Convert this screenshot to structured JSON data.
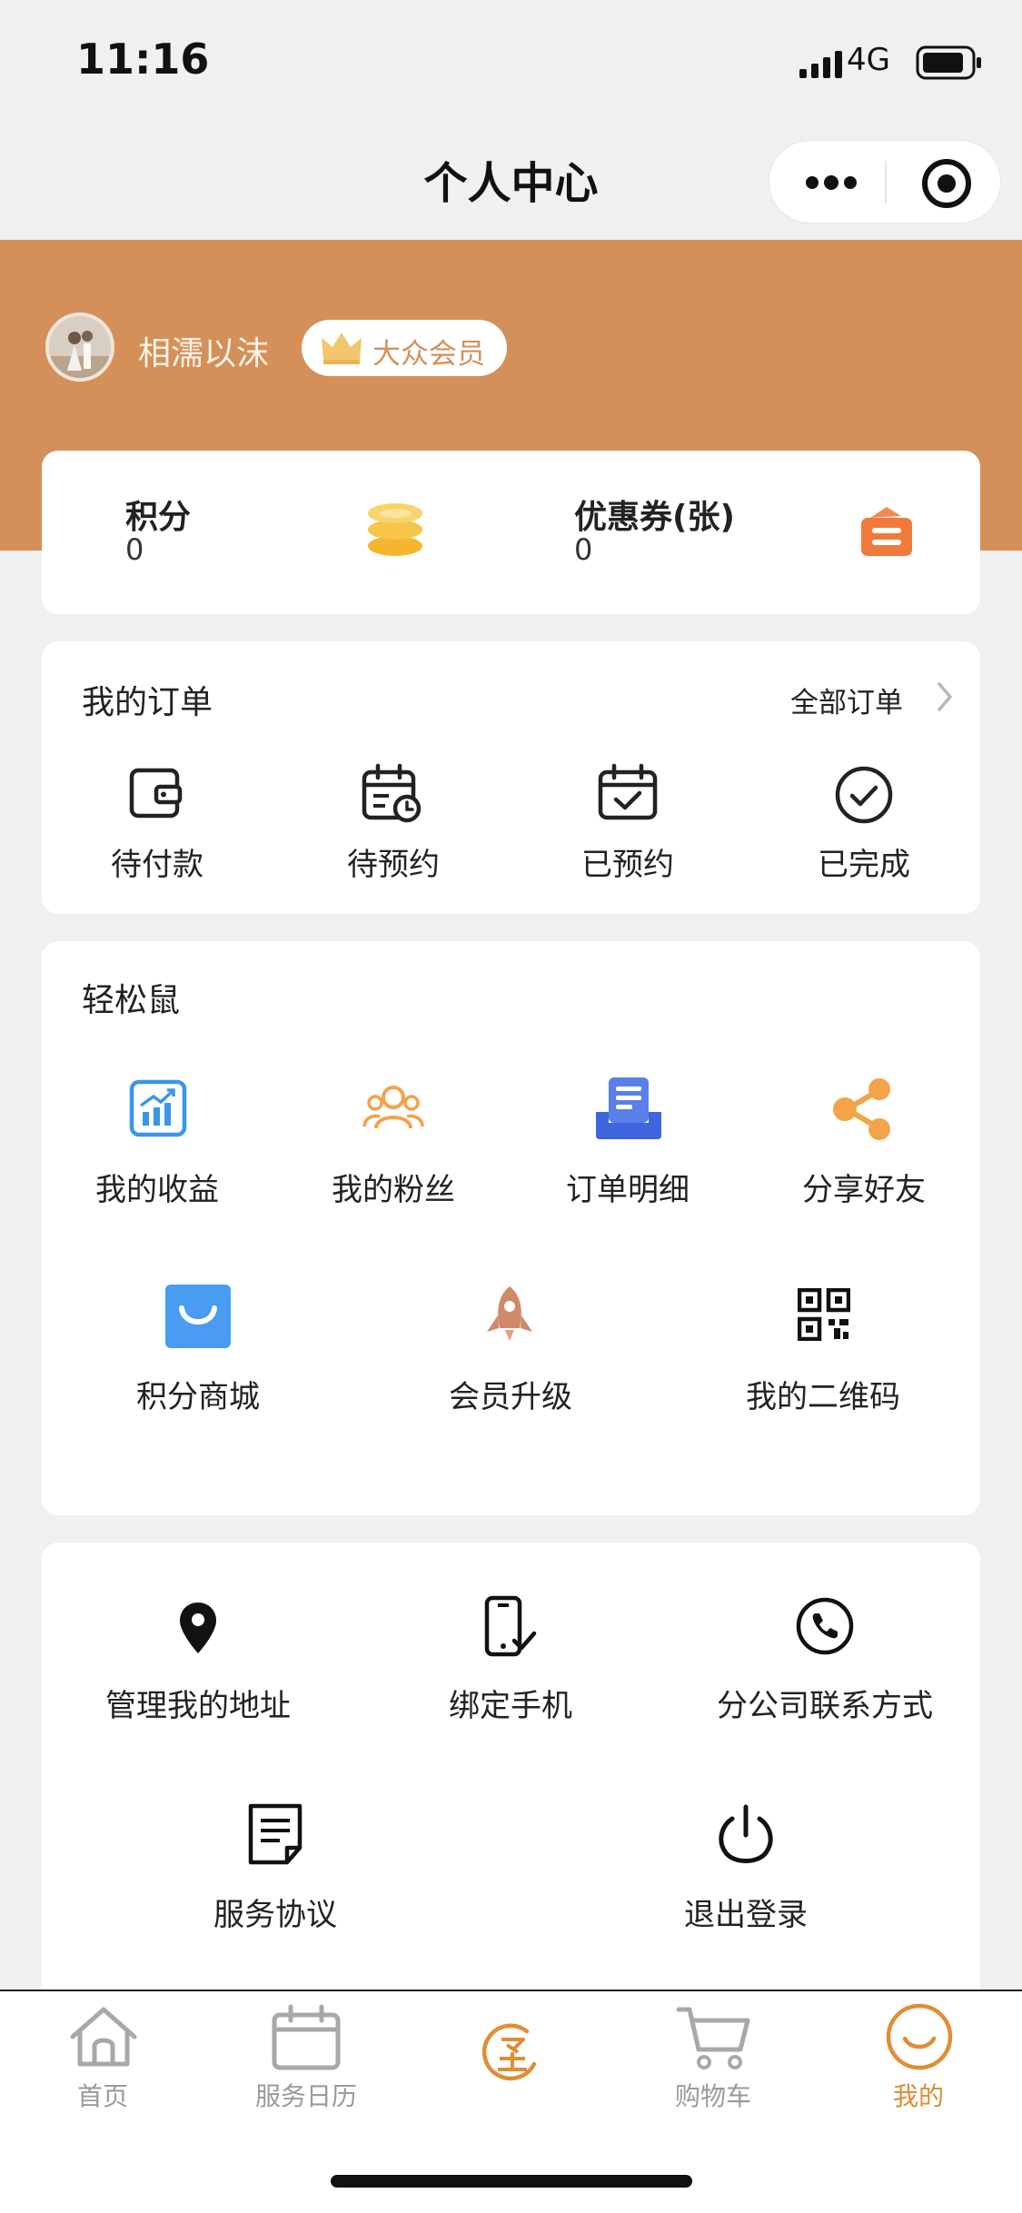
{
  "status_bar": {
    "time": "11:16",
    "network": "4G"
  },
  "nav": {
    "title": "个人中心"
  },
  "profile": {
    "username": "相濡以沫",
    "member_badge": "大众会员"
  },
  "stats": {
    "points_label": "积分",
    "points_value": "0",
    "coupons_label": "优惠券(张)",
    "coupons_value": "0"
  },
  "orders": {
    "title": "我的订单",
    "all_label": "全部订单",
    "items": [
      {
        "label": "待付款",
        "icon": "wallet-icon"
      },
      {
        "label": "待预约",
        "icon": "calendar-clock-icon"
      },
      {
        "label": "已预约",
        "icon": "calendar-check-icon"
      },
      {
        "label": "已完成",
        "icon": "check-circle-icon"
      }
    ]
  },
  "easy": {
    "title": "轻松鼠",
    "row1": [
      {
        "label": "我的收益",
        "icon": "earnings-chart-icon"
      },
      {
        "label": "我的粉丝",
        "icon": "fans-icon"
      },
      {
        "label": "订单明细",
        "icon": "order-detail-icon"
      },
      {
        "label": "分享好友",
        "icon": "share-icon"
      }
    ],
    "row2": [
      {
        "label": "积分商城",
        "icon": "shopping-bag-icon"
      },
      {
        "label": "会员升级",
        "icon": "rocket-icon"
      },
      {
        "label": "我的二维码",
        "icon": "qr-code-icon"
      }
    ]
  },
  "tools": {
    "row1": [
      {
        "label": "管理我的地址",
        "icon": "location-pin-icon"
      },
      {
        "label": "绑定手机",
        "icon": "phone-icon"
      },
      {
        "label": "分公司联系方式",
        "icon": "phone-call-icon"
      }
    ],
    "row2": [
      {
        "label": "服务协议",
        "icon": "document-icon"
      },
      {
        "label": "退出登录",
        "icon": "power-icon"
      }
    ]
  },
  "tabs": [
    {
      "label": "首页",
      "icon": "home-icon"
    },
    {
      "label": "服务日历",
      "icon": "calendar-icon"
    },
    {
      "label": "",
      "icon": "center-logo-icon"
    },
    {
      "label": "购物车",
      "icon": "cart-icon"
    },
    {
      "label": "我的",
      "icon": "profile-icon",
      "active": true
    }
  ],
  "colors": {
    "brand": "#d49058",
    "active_tab": "#e08d35",
    "inactive_tab": "#9a9a9a"
  }
}
